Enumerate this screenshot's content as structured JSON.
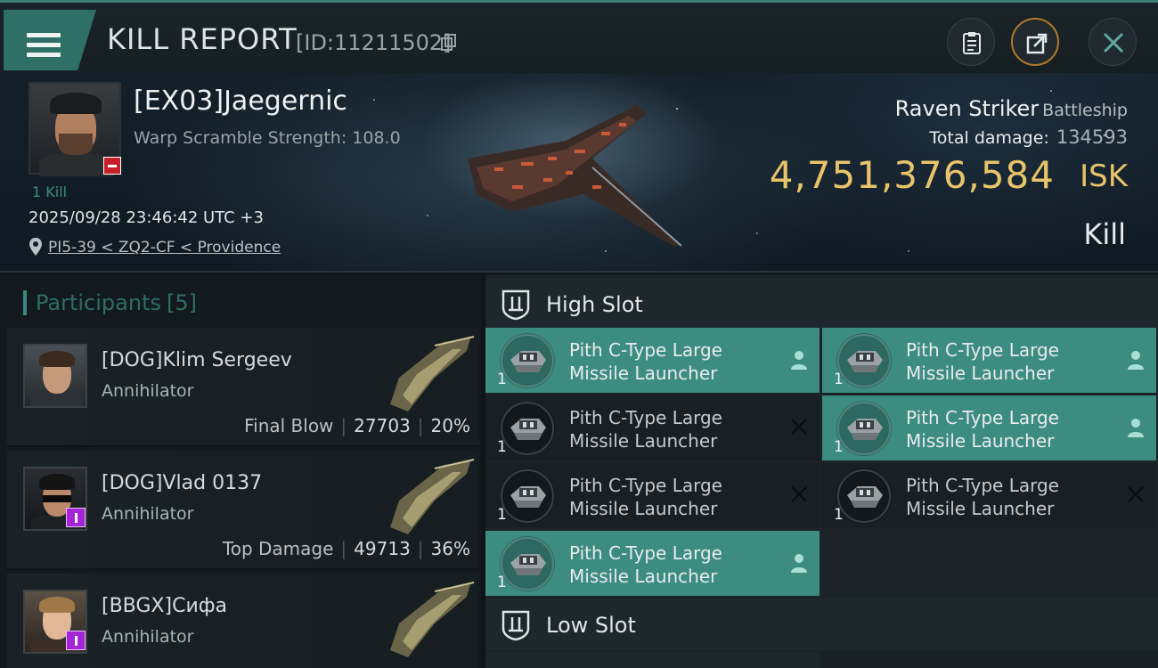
{
  "header": {
    "title": "KILL REPORT",
    "report_id": "[ID:11211502]"
  },
  "victim": {
    "pilot_name": "[EX03]Jaegernic",
    "warp_scramble": "Warp Scramble Strength: 108.0",
    "kills": "1 Kill",
    "datetime": "2025/09/28 23:46:42 UTC +3",
    "location": "PI5-39 < ZQ2-CF < Providence",
    "ship_name": "Raven Striker",
    "ship_class": "Battleship",
    "total_damage_label": "Total damage:",
    "total_damage_value": "134593",
    "isk_value": "4,751,376,584",
    "isk_unit": "ISK",
    "report_type": "Kill"
  },
  "participants": {
    "label": "Participants",
    "count": "[5]",
    "rows": [
      {
        "name": "[DOG]Klim Sergeev",
        "ship": "Annihilator",
        "role": "Final Blow",
        "damage": "27703",
        "percent": "20%"
      },
      {
        "name": "[DOG]Vlad 0137",
        "ship": "Annihilator",
        "role": "Top Damage",
        "damage": "49713",
        "percent": "36%"
      },
      {
        "name": "[BBGX]Сифа",
        "ship": "Annihilator"
      }
    ]
  },
  "slots": {
    "high_slot_title": "High Slot",
    "low_slot_title": "Low Slot",
    "high_items": [
      {
        "name": "Pith C-Type Large Missile Launcher",
        "qty": "1",
        "status": "fitted"
      },
      {
        "name": "Pith C-Type Large Missile Launcher",
        "qty": "1",
        "status": "fitted"
      },
      {
        "name": "Pith C-Type Large Missile Launcher",
        "qty": "1",
        "status": "destroyed"
      },
      {
        "name": "Pith C-Type Large Missile Launcher",
        "qty": "1",
        "status": "fitted"
      },
      {
        "name": "Pith C-Type Large Missile Launcher",
        "qty": "1",
        "status": "destroyed"
      },
      {
        "name": "Pith C-Type Large Missile Launcher",
        "qty": "1",
        "status": "destroyed"
      },
      {
        "name": "Pith C-Type Large Missile Launcher",
        "qty": "1",
        "status": "fitted"
      }
    ]
  },
  "colors": {
    "accent_teal": "#3d8c82",
    "isk_gold": "#e9c46a",
    "badge_red": "#c8202a",
    "badge_purple": "#a524d8"
  }
}
